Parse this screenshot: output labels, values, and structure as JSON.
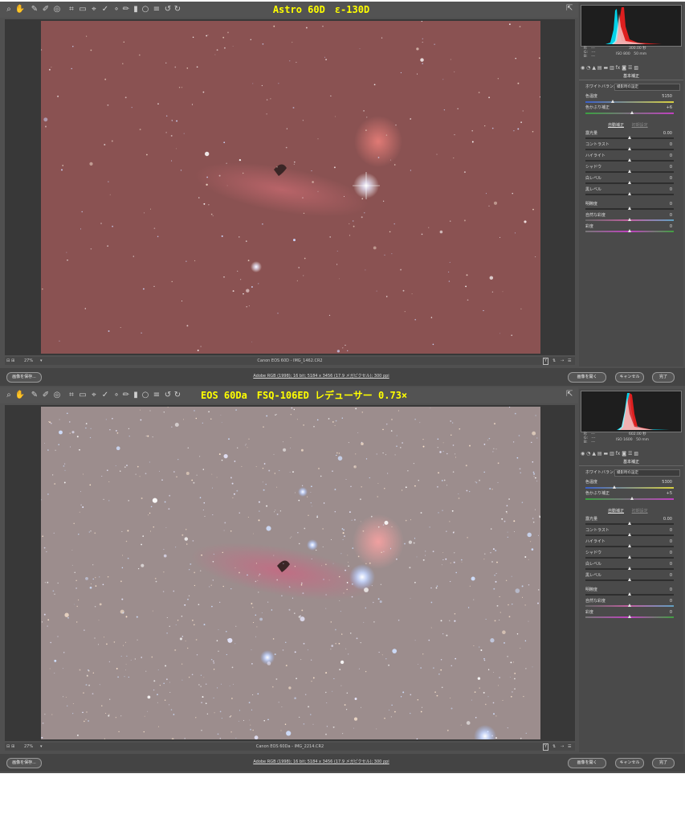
{
  "panels": [
    {
      "title": "Astro 60D　ε-130D",
      "rgb": {
        "r": "R:　---",
        "g": "G:　---",
        "b": "B:　---"
      },
      "exposure": "300.00 秒",
      "iso": "ISO 800　50 mm",
      "section": "基本補正",
      "wb_label": "ホワイトバランス：",
      "wb_value": "撮影時の設定",
      "temp_label": "色温度",
      "temp_value": "5150",
      "tint_label": "色かぶり補正",
      "tint_value": "+6",
      "auto": "自動補正",
      "default": "初期設定",
      "sliders": [
        {
          "label": "露光量",
          "value": "0.00"
        },
        {
          "label": "コントラスト",
          "value": "0"
        },
        {
          "label": "ハイライト",
          "value": "0"
        },
        {
          "label": "シャドウ",
          "value": "0"
        },
        {
          "label": "白レベル",
          "value": "0"
        },
        {
          "label": "黒レベル",
          "value": "0"
        }
      ],
      "sliders2": [
        {
          "label": "明瞭度",
          "value": "0"
        },
        {
          "label": "自然な彩度",
          "value": "0"
        },
        {
          "label": "彩度",
          "value": "0"
        }
      ],
      "zoom": "27%",
      "filename": "Canon EOS 60D - IMG_1462.CR2",
      "save_button": "画像を保存...",
      "info_link": "Adobe RGB (1998); 16 bit; 5184 x 3456 (17.9 メガピクセル); 300 ppi",
      "open_button": "画像を開く",
      "cancel_button": "キャンセル",
      "done_button": "完了",
      "tone": "red"
    },
    {
      "title": "EOS 60Da　FSQ-106ED レデューサー 0.73×",
      "rgb": {
        "r": "R:　---",
        "g": "G:　---",
        "b": "B:　---"
      },
      "exposure": "602.00 秒",
      "iso": "ISO 1600　50 mm",
      "section": "基本補正",
      "wb_label": "ホワイトバランス：",
      "wb_value": "撮影時の設定",
      "temp_label": "色温度",
      "temp_value": "5300",
      "tint_label": "色かぶり補正",
      "tint_value": "+5",
      "auto": "自動補正",
      "default": "初期設定",
      "sliders": [
        {
          "label": "露光量",
          "value": "0.00"
        },
        {
          "label": "コントラスト",
          "value": "0"
        },
        {
          "label": "ハイライト",
          "value": "0"
        },
        {
          "label": "シャドウ",
          "value": "0"
        },
        {
          "label": "白レベル",
          "value": "0"
        },
        {
          "label": "黒レベル",
          "value": "0"
        }
      ],
      "sliders2": [
        {
          "label": "明瞭度",
          "value": "0"
        },
        {
          "label": "自然な彩度",
          "value": "0"
        },
        {
          "label": "彩度",
          "value": "0"
        }
      ],
      "zoom": "27%",
      "filename": "Canon EOS 60Da - IMG_2214.CR2",
      "save_button": "画像を保存...",
      "info_link": "Adobe RGB (1998); 16 bit; 5184 x 3456 (17.9 メガピクセル); 300 ppi",
      "open_button": "画像を開く",
      "cancel_button": "キャンセル",
      "done_button": "完了",
      "tone": "neutral"
    }
  ],
  "colors": {
    "title": "#ffff00",
    "panel_bg": "#505050",
    "red_sky": "#8a5252",
    "neutral_sky": "#9c8d8d"
  }
}
